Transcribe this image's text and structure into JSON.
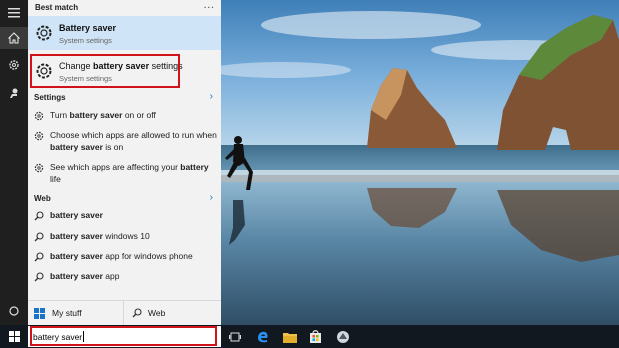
{
  "search_panel": {
    "best_match_header": "Best match",
    "more_label": "···",
    "results": [
      {
        "title_bold": "Battery saver",
        "subtitle": "System settings",
        "icon": "gear-icon"
      },
      {
        "title_prefix": "Change ",
        "title_bold": "battery saver",
        "title_suffix": " settings",
        "subtitle": "System settings",
        "icon": "gear-icon"
      }
    ],
    "settings_header": "Settings",
    "settings_items": [
      {
        "prefix": "Turn ",
        "bold": "battery saver",
        "suffix": " on or off",
        "icon": "gear-icon"
      },
      {
        "prefix": "Choose which apps are allowed to run when ",
        "bold": "battery saver",
        "suffix": " is on",
        "icon": "gear-icon"
      },
      {
        "prefix": "See which apps are affecting your ",
        "bold": "battery",
        "suffix": " life",
        "icon": "gear-icon"
      }
    ],
    "web_header": "Web",
    "web_items": [
      {
        "bold": "battery saver",
        "suffix": "",
        "icon": "search-icon"
      },
      {
        "bold": "battery saver",
        "suffix": " windows 10",
        "icon": "search-icon"
      },
      {
        "bold": "battery saver",
        "suffix": " app for windows phone",
        "icon": "search-icon"
      },
      {
        "bold": "battery saver",
        "suffix": " app",
        "icon": "search-icon"
      }
    ],
    "my_stuff_label": "My stuff",
    "web_button_label": "Web"
  },
  "taskbar": {
    "search_value": "battery saver",
    "icons": [
      "start-icon",
      "task-view-icon",
      "edge-icon",
      "file-explorer-icon",
      "store-icon",
      "app-icon"
    ]
  },
  "rail_icons": [
    "hamburger-icon",
    "home-icon",
    "settings-icon",
    "feedback-icon",
    "power-icon"
  ],
  "colors": {
    "highlight": "#cfe4f7",
    "panel": "#f2f2f2",
    "annotation_red": "#d0121b",
    "accent_blue": "#1a73c7"
  }
}
